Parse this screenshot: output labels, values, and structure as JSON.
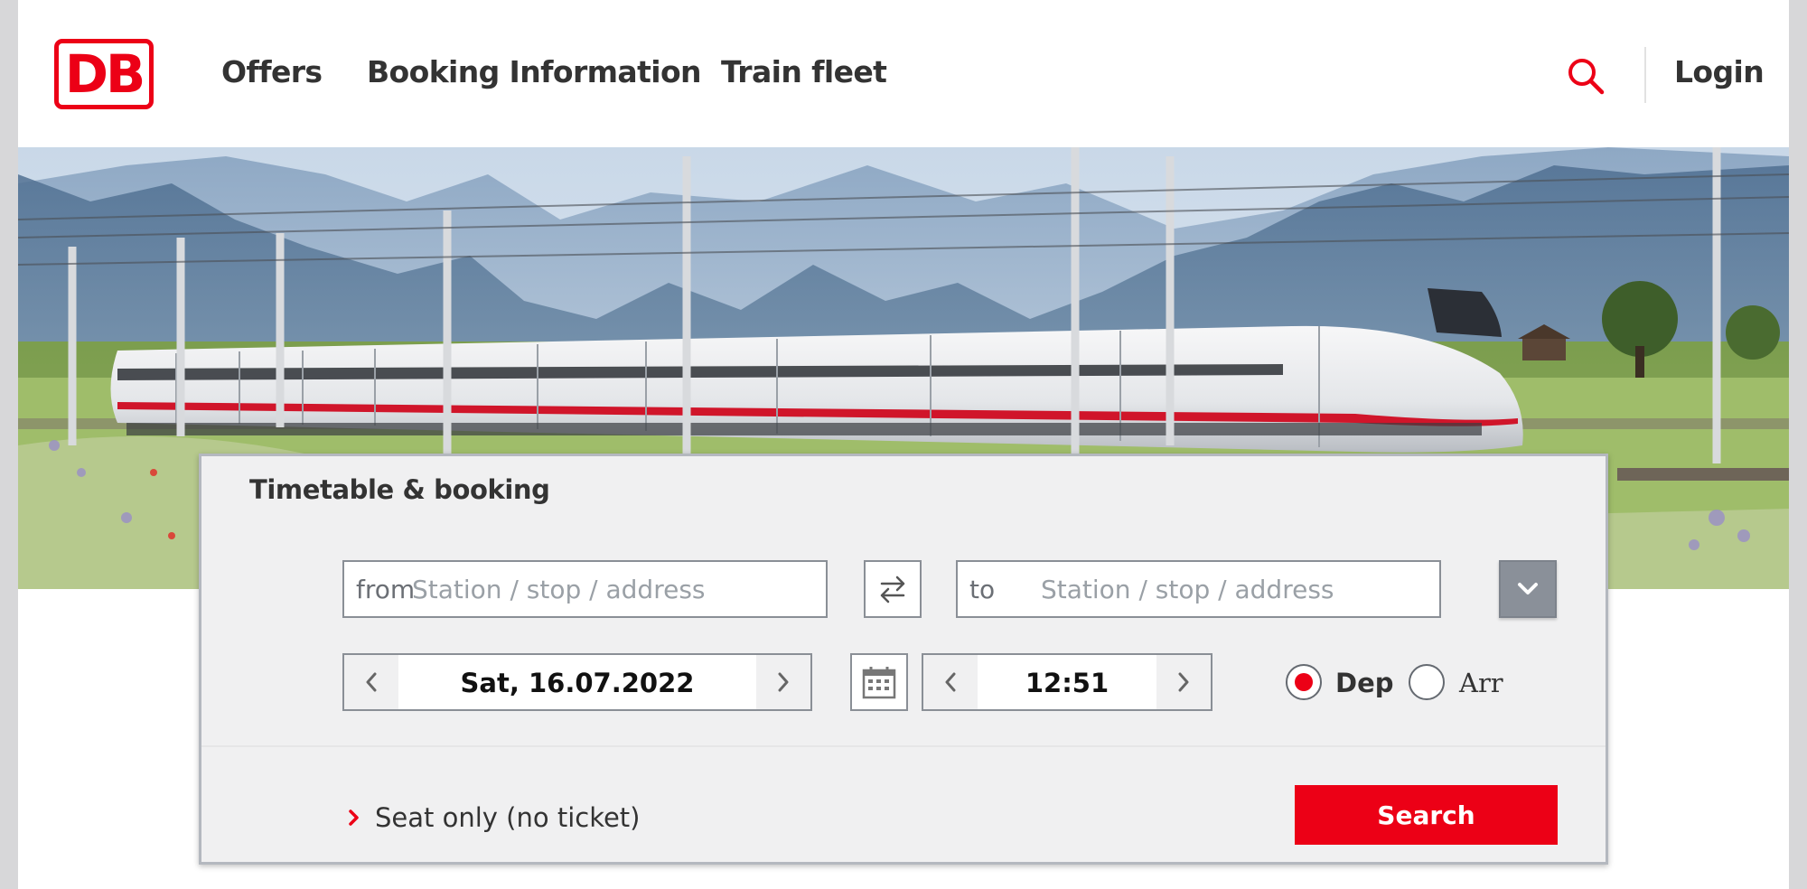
{
  "header": {
    "logo_text": "DB",
    "nav": [
      "Offers",
      "Booking Information",
      "Train fleet"
    ],
    "login_label": "Login",
    "search_icon": "search-icon"
  },
  "booking": {
    "title": "Timetable & booking",
    "from": {
      "prefix": "from",
      "placeholder": "Station / stop / address",
      "value": ""
    },
    "to": {
      "prefix": "to",
      "placeholder": "Station / stop / address",
      "value": ""
    },
    "date": "Sat, 16.07.2022",
    "time": "12:51",
    "dep_label": "Dep",
    "arr_label": "Arr",
    "selected_mode": "Dep",
    "seat_only_label": "Seat only (no ticket)",
    "search_label": "Search"
  },
  "colors": {
    "brand_red": "#ec0016",
    "text_dark": "#333333",
    "panel_bg": "#f0f0f1",
    "border_grey": "#8a8f96"
  },
  "icons": [
    "search-icon",
    "swap-icon",
    "chevron-down-icon",
    "chevron-left-icon",
    "chevron-right-icon",
    "calendar-icon",
    "chevron-right-red-icon"
  ]
}
